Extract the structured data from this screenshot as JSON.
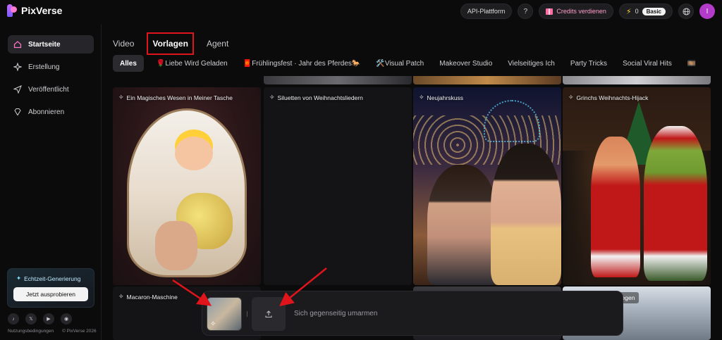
{
  "app": {
    "name": "PixVerse"
  },
  "topbar": {
    "api_label": "API-Plattform",
    "help_icon": "question-icon",
    "credits_label": "Credits verdienen",
    "credits_count": "0",
    "plan_badge": "Basic",
    "language_icon": "globe-icon",
    "avatar_letter": "I"
  },
  "sidebar": {
    "items": [
      {
        "label": "Startseite",
        "icon": "home-icon"
      },
      {
        "label": "Erstellung",
        "icon": "sparkle-icon"
      },
      {
        "label": "Veröffentlicht",
        "icon": "send-icon"
      },
      {
        "label": "Abonnieren",
        "icon": "diamond-icon"
      }
    ],
    "promo": {
      "title": "Echtzeit-Generierung",
      "button": "Jetzt ausprobieren"
    },
    "socials": [
      "tiktok-icon",
      "x-icon",
      "youtube-icon",
      "discord-icon"
    ],
    "footer": {
      "terms": "Nutzungsbedingungen",
      "copyright": "© PixVerse 2026"
    }
  },
  "main_tabs": [
    {
      "label": "Video",
      "active": false
    },
    {
      "label": "Vorlagen",
      "active": true
    },
    {
      "label": "Agent",
      "active": false
    }
  ],
  "categories": [
    {
      "label": "Alles",
      "active": true
    },
    {
      "label": "🌹Liebe Wird Geladen"
    },
    {
      "label": "🧧Frühlingsfest · Jahr des Pferdes🐎"
    },
    {
      "label": "🛠️Visual Patch"
    },
    {
      "label": "Makeover Studio"
    },
    {
      "label": "Vielseitiges Ich"
    },
    {
      "label": "Party Tricks"
    },
    {
      "label": "Social Viral Hits"
    },
    {
      "label": "🎞️"
    }
  ],
  "cards": [
    {
      "title": "Ein Magisches Wesen in Meiner Tasche"
    },
    {
      "title": "Siluetten von Weihnachtsliedern"
    },
    {
      "title": "Neujahrskuss"
    },
    {
      "title": "Grinchs Weihnachts-Hijack"
    }
  ],
  "row2": {
    "card1_title": "Macaron-Maschine",
    "card4_title": "ann Fliegen"
  },
  "prompt_bar": {
    "placeholder": "Sich gegenseitig umarmen"
  },
  "colors": {
    "accent_red_box": "#e0141b",
    "arrow_red": "#e0141b",
    "credits_pink": "#ff9fc8",
    "avatar_purple": "#b23cc9"
  }
}
